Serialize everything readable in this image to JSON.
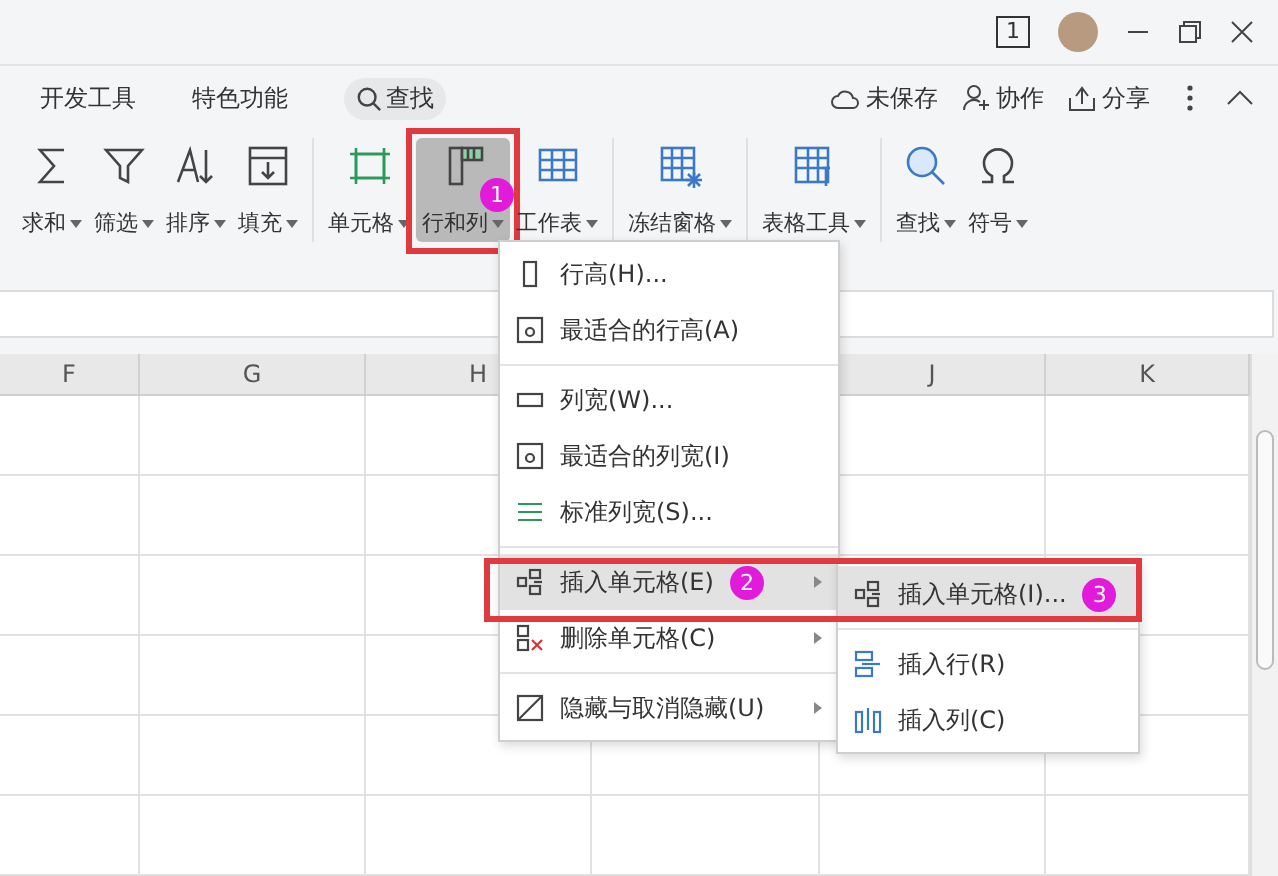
{
  "title_bar": {
    "page_count": "1"
  },
  "tabs": {
    "items": [
      {
        "label": "开发工具"
      },
      {
        "label": "特色功能"
      }
    ],
    "search": {
      "label": "查找"
    },
    "actions": [
      {
        "kind": "cloud",
        "label": "未保存"
      },
      {
        "kind": "user",
        "label": "协作"
      },
      {
        "kind": "share",
        "label": "分享"
      }
    ]
  },
  "ribbon": {
    "groups": [
      [
        {
          "kind": "sum",
          "label": "求和",
          "selected": false
        },
        {
          "kind": "filter",
          "label": "筛选",
          "selected": false
        },
        {
          "kind": "sort",
          "label": "排序",
          "selected": false
        },
        {
          "kind": "fill",
          "label": "填充",
          "selected": false
        }
      ],
      [
        {
          "kind": "cell",
          "label": "单元格",
          "selected": false
        },
        {
          "kind": "rowcol",
          "label": "行和列",
          "selected": true,
          "callout": "1"
        },
        {
          "kind": "sheet",
          "label": "工作表",
          "selected": false
        }
      ],
      [
        {
          "kind": "freeze",
          "label": "冻结窗格",
          "selected": false
        }
      ],
      [
        {
          "kind": "tools",
          "label": "表格工具",
          "selected": false
        }
      ],
      [
        {
          "kind": "find",
          "label": "查找",
          "selected": false
        },
        {
          "kind": "symbol",
          "label": "符号",
          "selected": false
        }
      ]
    ]
  },
  "sheet": {
    "columns": [
      "F",
      "G",
      "H",
      "J",
      "K"
    ]
  },
  "menu": {
    "groups": [
      [
        {
          "kind": "rowheight",
          "label": "行高(H)...",
          "submenu": false,
          "selected": false
        },
        {
          "kind": "fit",
          "label": "最适合的行高(A)",
          "submenu": false,
          "selected": false
        }
      ],
      [
        {
          "kind": "colwidth",
          "label": "列宽(W)...",
          "submenu": false,
          "selected": false
        },
        {
          "kind": "fit",
          "label": "最适合的列宽(I)",
          "submenu": false,
          "selected": false
        },
        {
          "kind": "stdwidth",
          "label": "标准列宽(S)...",
          "submenu": false,
          "selected": false
        }
      ],
      [
        {
          "kind": "insert",
          "label": "插入单元格(E)",
          "submenu": true,
          "selected": true,
          "callout": "2"
        },
        {
          "kind": "delete",
          "label": "删除单元格(C)",
          "submenu": true,
          "selected": false
        }
      ],
      [
        {
          "kind": "hide",
          "label": "隐藏与取消隐藏(U)",
          "submenu": true,
          "selected": false
        }
      ]
    ]
  },
  "submenu": {
    "groups": [
      [
        {
          "kind": "insert",
          "label": "插入单元格(I)...",
          "selected": true,
          "callout": "3"
        }
      ],
      [
        {
          "kind": "insertrow",
          "label": "插入行(R)",
          "selected": false
        },
        {
          "kind": "insertcol",
          "label": "插入列(C)",
          "selected": false
        }
      ]
    ]
  }
}
